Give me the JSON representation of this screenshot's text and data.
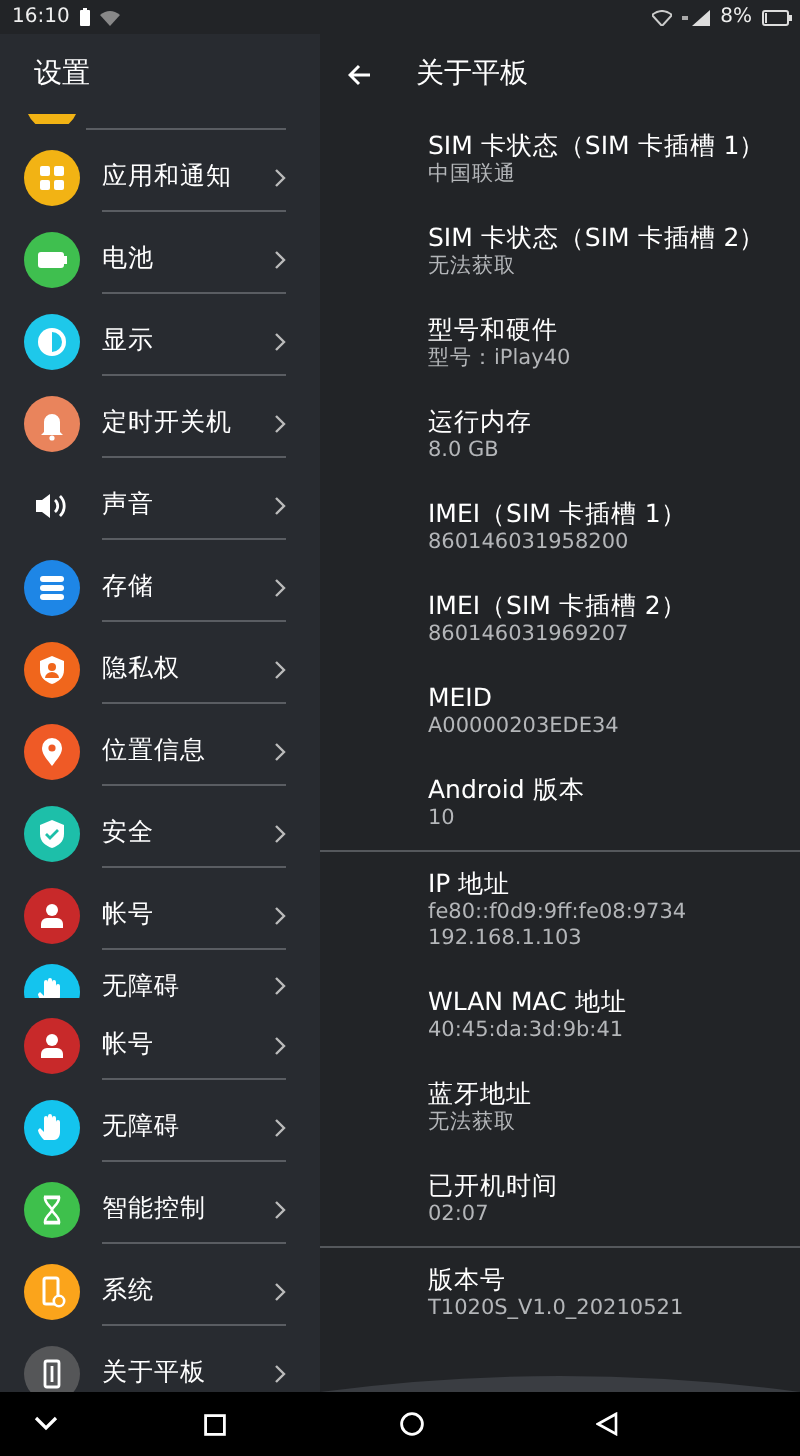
{
  "status_bar": {
    "time": "16:10",
    "battery": "8%"
  },
  "settings_list": {
    "title": "设置",
    "items": [
      {
        "label": "应用和通知",
        "kind": "apps",
        "clipped": false
      },
      {
        "label": "电池",
        "kind": "battery",
        "clipped": false
      },
      {
        "label": "显示",
        "kind": "display",
        "clipped": false
      },
      {
        "label": "定时开关机",
        "kind": "schedule",
        "clipped": false
      },
      {
        "label": "声音",
        "kind": "sound",
        "clipped": false
      },
      {
        "label": "存储",
        "kind": "storage",
        "clipped": false
      },
      {
        "label": "隐私权",
        "kind": "privacy",
        "clipped": false
      },
      {
        "label": "位置信息",
        "kind": "location",
        "clipped": false
      },
      {
        "label": "安全",
        "kind": "security",
        "clipped": false
      },
      {
        "label": "帐号",
        "kind": "account",
        "clipped": false
      },
      {
        "label": "无障碍",
        "kind": "accessibility",
        "clipped": true
      },
      {
        "label": "帐号",
        "kind": "account",
        "clipped": false
      },
      {
        "label": "无障碍",
        "kind": "accessibility",
        "clipped": false
      },
      {
        "label": "智能控制",
        "kind": "smart",
        "clipped": false
      },
      {
        "label": "系统",
        "kind": "system",
        "clipped": false
      },
      {
        "label": "关于平板",
        "kind": "about",
        "clipped": false
      }
    ]
  },
  "detail": {
    "title": "关于平板",
    "sections": [
      [
        {
          "title": "SIM 卡状态（SIM 卡插槽 1）",
          "summary": [
            "中国联通"
          ]
        },
        {
          "title": "SIM 卡状态（SIM 卡插槽 2）",
          "summary": [
            "无法获取"
          ]
        },
        {
          "title": "型号和硬件",
          "summary": [
            "型号：iPlay40"
          ]
        },
        {
          "title": "运行内存",
          "summary": [
            "8.0 GB"
          ]
        },
        {
          "title": "IMEI（SIM 卡插槽 1）",
          "summary": [
            "860146031958200"
          ]
        },
        {
          "title": "IMEI（SIM 卡插槽 2）",
          "summary": [
            "860146031969207"
          ]
        },
        {
          "title": "MEID",
          "summary": [
            "A00000203EDE34"
          ]
        },
        {
          "title": "Android 版本",
          "summary": [
            "10"
          ]
        }
      ],
      [
        {
          "title": "IP 地址",
          "summary": [
            "fe80::f0d9:9ff:fe08:9734",
            "192.168.1.103"
          ]
        },
        {
          "title": "WLAN MAC 地址",
          "summary": [
            "40:45:da:3d:9b:41"
          ]
        },
        {
          "title": "蓝牙地址",
          "summary": [
            "无法获取"
          ]
        },
        {
          "title": "已开机时间",
          "summary": [
            "02:07"
          ]
        }
      ],
      [
        {
          "title": "版本号",
          "summary": [
            "T1020S_V1.0_20210521"
          ]
        }
      ]
    ]
  }
}
